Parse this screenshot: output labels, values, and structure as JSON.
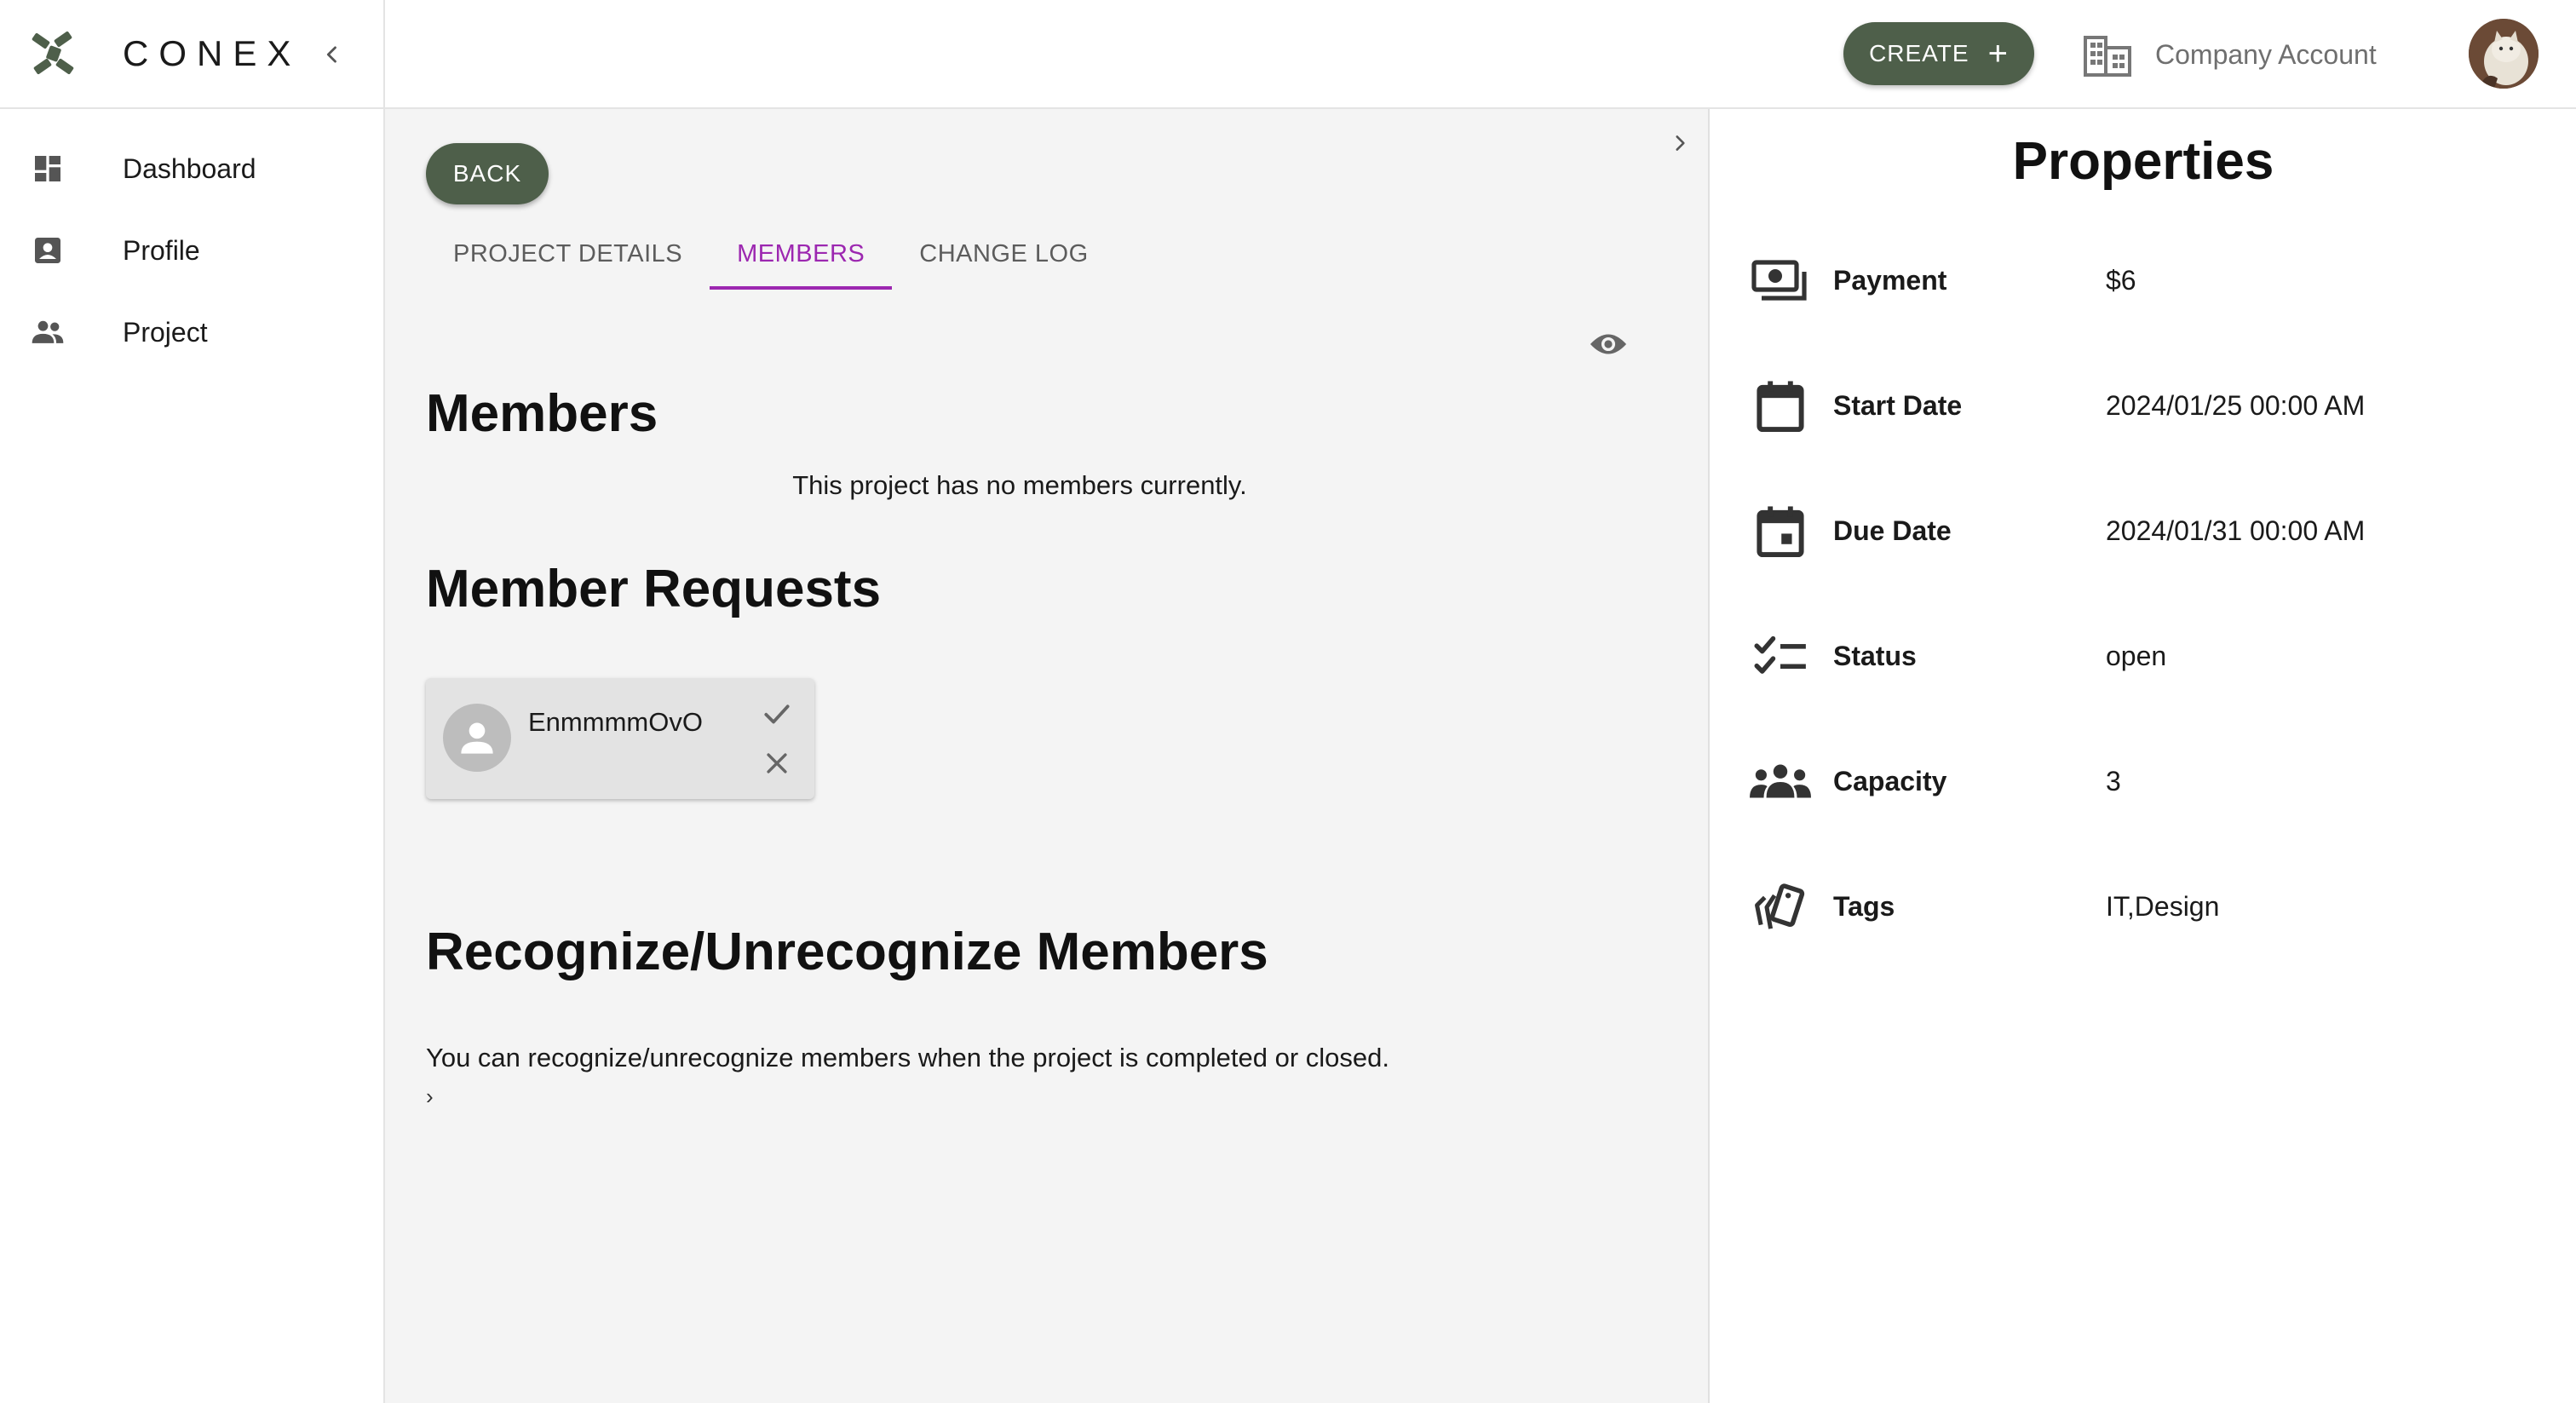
{
  "brand": {
    "name": "CONEX"
  },
  "sidebar": {
    "items": [
      {
        "label": "Dashboard",
        "icon": "dashboard-icon"
      },
      {
        "label": "Profile",
        "icon": "profile-icon"
      },
      {
        "label": "Project",
        "icon": "people-icon"
      }
    ]
  },
  "topbar": {
    "create_label": "CREATE",
    "create_icon": "+",
    "company_label": "Company Account"
  },
  "main": {
    "back_label": "BACK",
    "tabs": [
      {
        "label": "PROJECT DETAILS",
        "active": false
      },
      {
        "label": "MEMBERS",
        "active": true
      },
      {
        "label": "CHANGE LOG",
        "active": false
      }
    ],
    "members_title": "Members",
    "no_members_text": "This project has no members currently.",
    "requests_title": "Member Requests",
    "requests": [
      {
        "name": "EnmmmmOvO"
      }
    ],
    "recognize_title": "Recognize/Unrecognize Members",
    "recognize_text": "You can recognize/unrecognize members when the project is completed or closed.",
    "small_arrow": "›"
  },
  "properties": {
    "title": "Properties",
    "rows": [
      {
        "label": "Payment",
        "value": "$6",
        "icon": "payments-icon"
      },
      {
        "label": "Start Date",
        "value": "2024/01/25 00:00 AM",
        "icon": "calendar-icon"
      },
      {
        "label": "Due Date",
        "value": "2024/01/31 00:00 AM",
        "icon": "event-icon"
      },
      {
        "label": "Status",
        "value": "open",
        "icon": "checklist-icon"
      },
      {
        "label": "Capacity",
        "value": "3",
        "icon": "groups-icon"
      },
      {
        "label": "Tags",
        "value": "IT,Design",
        "icon": "tags-icon"
      }
    ]
  },
  "colors": {
    "primary": "#4e5f4a",
    "tab_active": "#9c27b0",
    "main_bg": "#f4f4f4"
  }
}
